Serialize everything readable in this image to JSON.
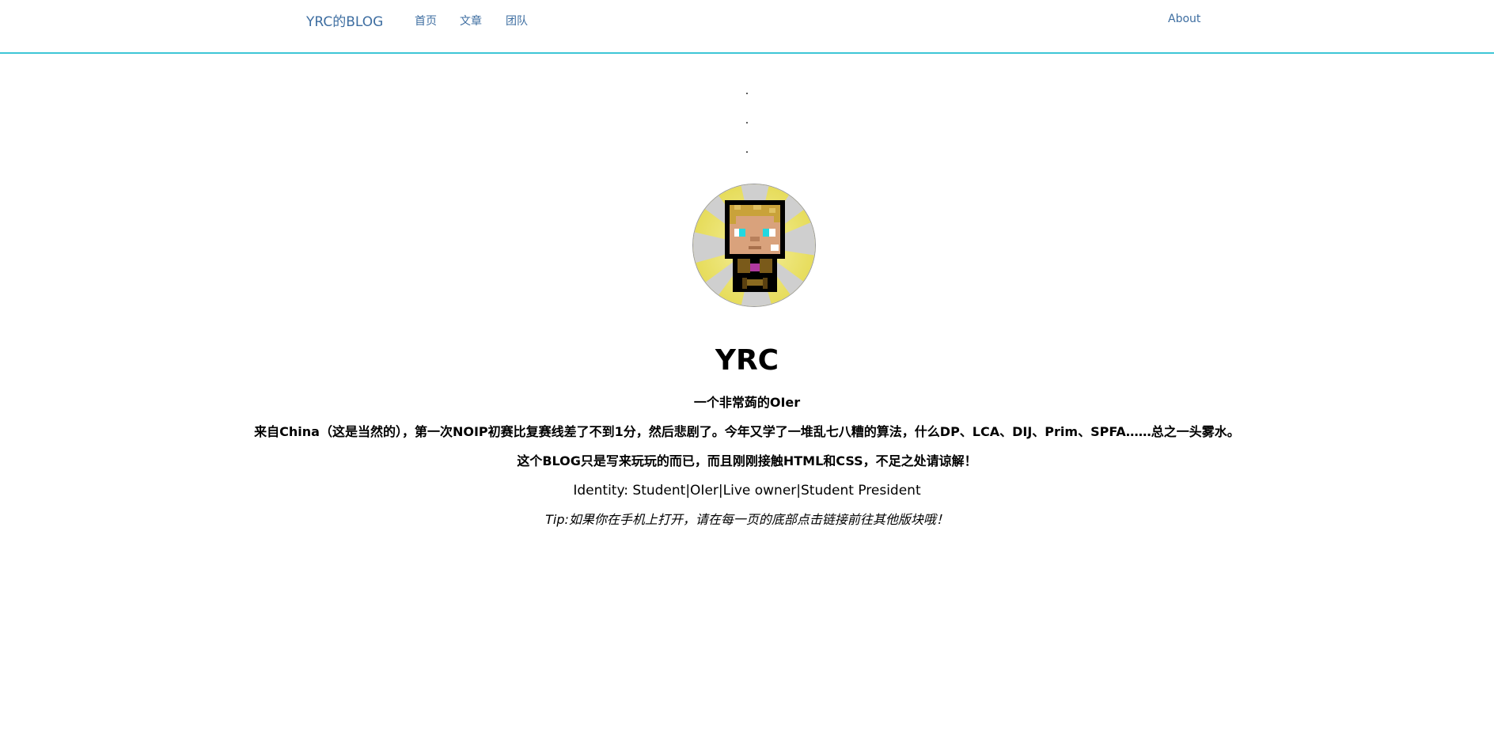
{
  "nav": {
    "brand": "YRC的BLOG",
    "links": [
      {
        "label": "首页"
      },
      {
        "label": "文章"
      },
      {
        "label": "团队"
      }
    ],
    "about": "About"
  },
  "dots": [
    ".",
    ".",
    "."
  ],
  "profile": {
    "name": "YRC",
    "subtitle": "一个非常蒟的OIer",
    "bio_line1": "来自China（这是当然的），第一次NOIP初赛比复赛线差了不到1分，然后悲剧了。今年又学了一堆乱七八糟的算法，什么DP、LCA、DIJ、Prim、SPFA……总之一头雾水。",
    "bio_line2": "这个BLOG只是写来玩玩的而已，而且刚刚接触HTML和CSS，不足之处请谅解！",
    "identity": "Identity: Student|OIer|Live owner|Student President",
    "tip": "Tip:如果你在手机上打开，请在每一页的底部点击链接前往其他版块哦！"
  },
  "colors": {
    "link": "#3e6ea1",
    "nav_border": "#3ec6d6"
  },
  "icons": {
    "avatar": "pixel-character-avatar"
  }
}
